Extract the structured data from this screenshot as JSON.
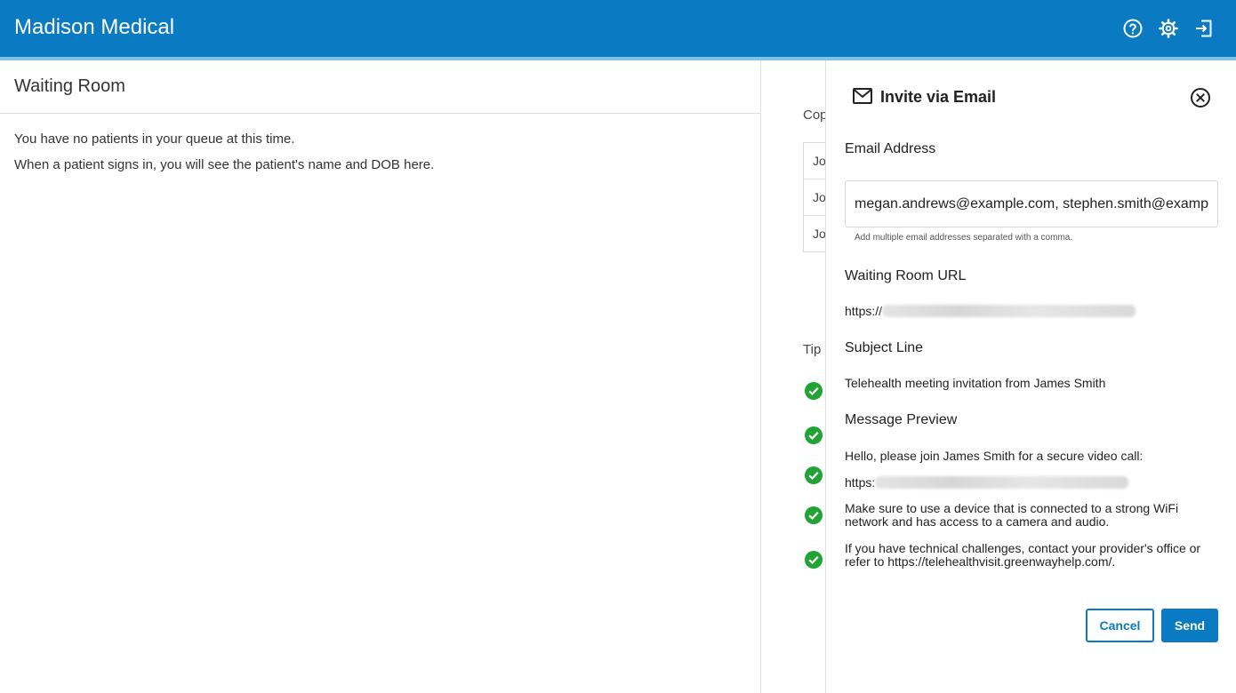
{
  "app": {
    "title": "Madison Medical",
    "icons": [
      "help-icon",
      "gear-icon",
      "sign-out-icon"
    ],
    "brand_color": "#0a7bc2"
  },
  "waiting_room": {
    "title": "Waiting Room",
    "empty_line1": "You have no patients in your queue at this time.",
    "empty_line2": "When a patient signs in, you will see the patient's name and DOB here."
  },
  "background_panel": {
    "copy_label": "Cop",
    "rows": [
      "Jo",
      "Jo",
      "Jo"
    ],
    "tips_label": "Tip"
  },
  "invite": {
    "title": "Invite via Email",
    "email_label": "Email Address",
    "email_value": "megan.andrews@example.com, stephen.smith@example.com",
    "email_hint": "Add multiple email addresses separated with a comma.",
    "url_label": "Waiting Room URL",
    "url_prefix": "https://",
    "subject_label": "Subject Line",
    "subject_value": "Telehealth meeting invitation from James Smith",
    "preview_label": "Message Preview",
    "preview_line1": "Hello, please join James Smith for a secure video call:",
    "preview_url_prefix": "https:",
    "preview_line2": "Make sure to use a device that is connected to a strong WiFi network and has access to a camera and audio.",
    "preview_line3": "If you have technical challenges, contact your provider's office or refer to https://telehealthvisit.greenwayhelp.com/.",
    "cancel_label": "Cancel",
    "send_label": "Send"
  }
}
